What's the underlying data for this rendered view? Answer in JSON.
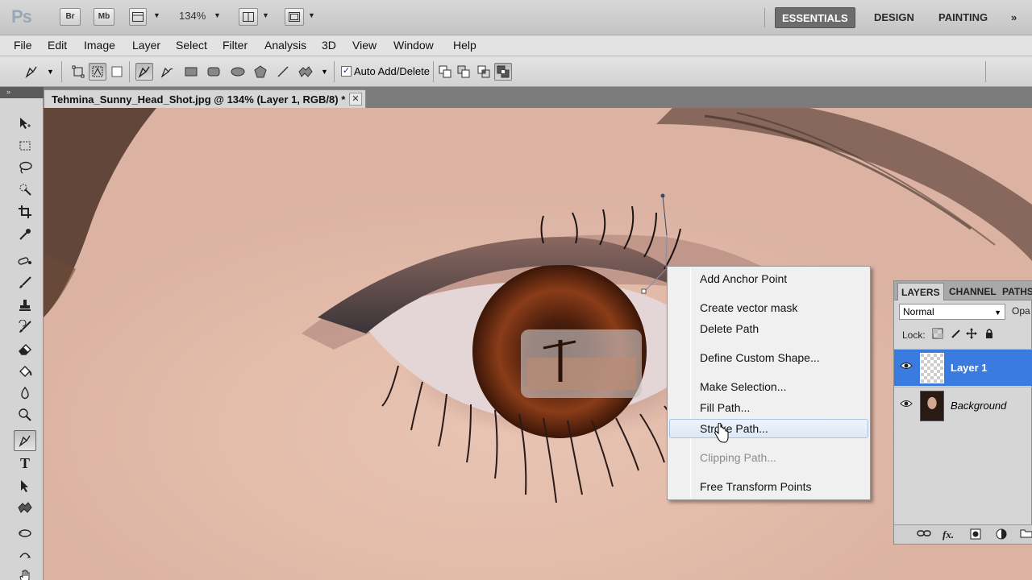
{
  "app": {
    "logo": "Ps",
    "bridge_label": "Br",
    "minibridge_label": "Mb",
    "zoom_value": "134%",
    "workspaces": [
      "ESSENTIALS",
      "DESIGN",
      "PAINTING"
    ],
    "more_workspaces": "»"
  },
  "menu": {
    "items": [
      "File",
      "Edit",
      "Image",
      "Layer",
      "Select",
      "Filter",
      "Analysis",
      "3D",
      "View",
      "Window",
      "Help"
    ]
  },
  "options": {
    "auto_add_delete_label": "Auto Add/Delete",
    "auto_add_delete_checked": "✓"
  },
  "document": {
    "tab_title": "Tehmina_Sunny_Head_Shot.jpg @ 134% (Layer 1, RGB/8) *",
    "close_glyph": "✕"
  },
  "tools_panel": {
    "grip_glyph": "»"
  },
  "context_menu": {
    "items": [
      {
        "label": "Add Anchor Point",
        "state": "normal"
      },
      {
        "label": "Create vector mask",
        "state": "normal"
      },
      {
        "label": "Delete Path",
        "state": "normal"
      },
      {
        "label": "Define Custom Shape...",
        "state": "normal"
      },
      {
        "label": "Make Selection...",
        "state": "normal"
      },
      {
        "label": "Fill Path...",
        "state": "normal"
      },
      {
        "label": "Stroke Path...",
        "state": "hover"
      },
      {
        "label": "Clipping Path...",
        "state": "disabled"
      },
      {
        "label": "Free Transform Points",
        "state": "normal"
      }
    ]
  },
  "layers_panel": {
    "tabs": [
      "LAYERS",
      "CHANNEL",
      "PATHS"
    ],
    "blend_mode": "Normal",
    "opacity_label": "Opa",
    "lock_label": "Lock:",
    "layers": [
      {
        "name": "Layer 1",
        "selected": true
      },
      {
        "name": "Background",
        "selected": false
      }
    ]
  },
  "colors": {
    "selection_blue": "#3a7be0",
    "menu_hover": "#dde8f5",
    "workspace_active": "#6c6c6c"
  }
}
